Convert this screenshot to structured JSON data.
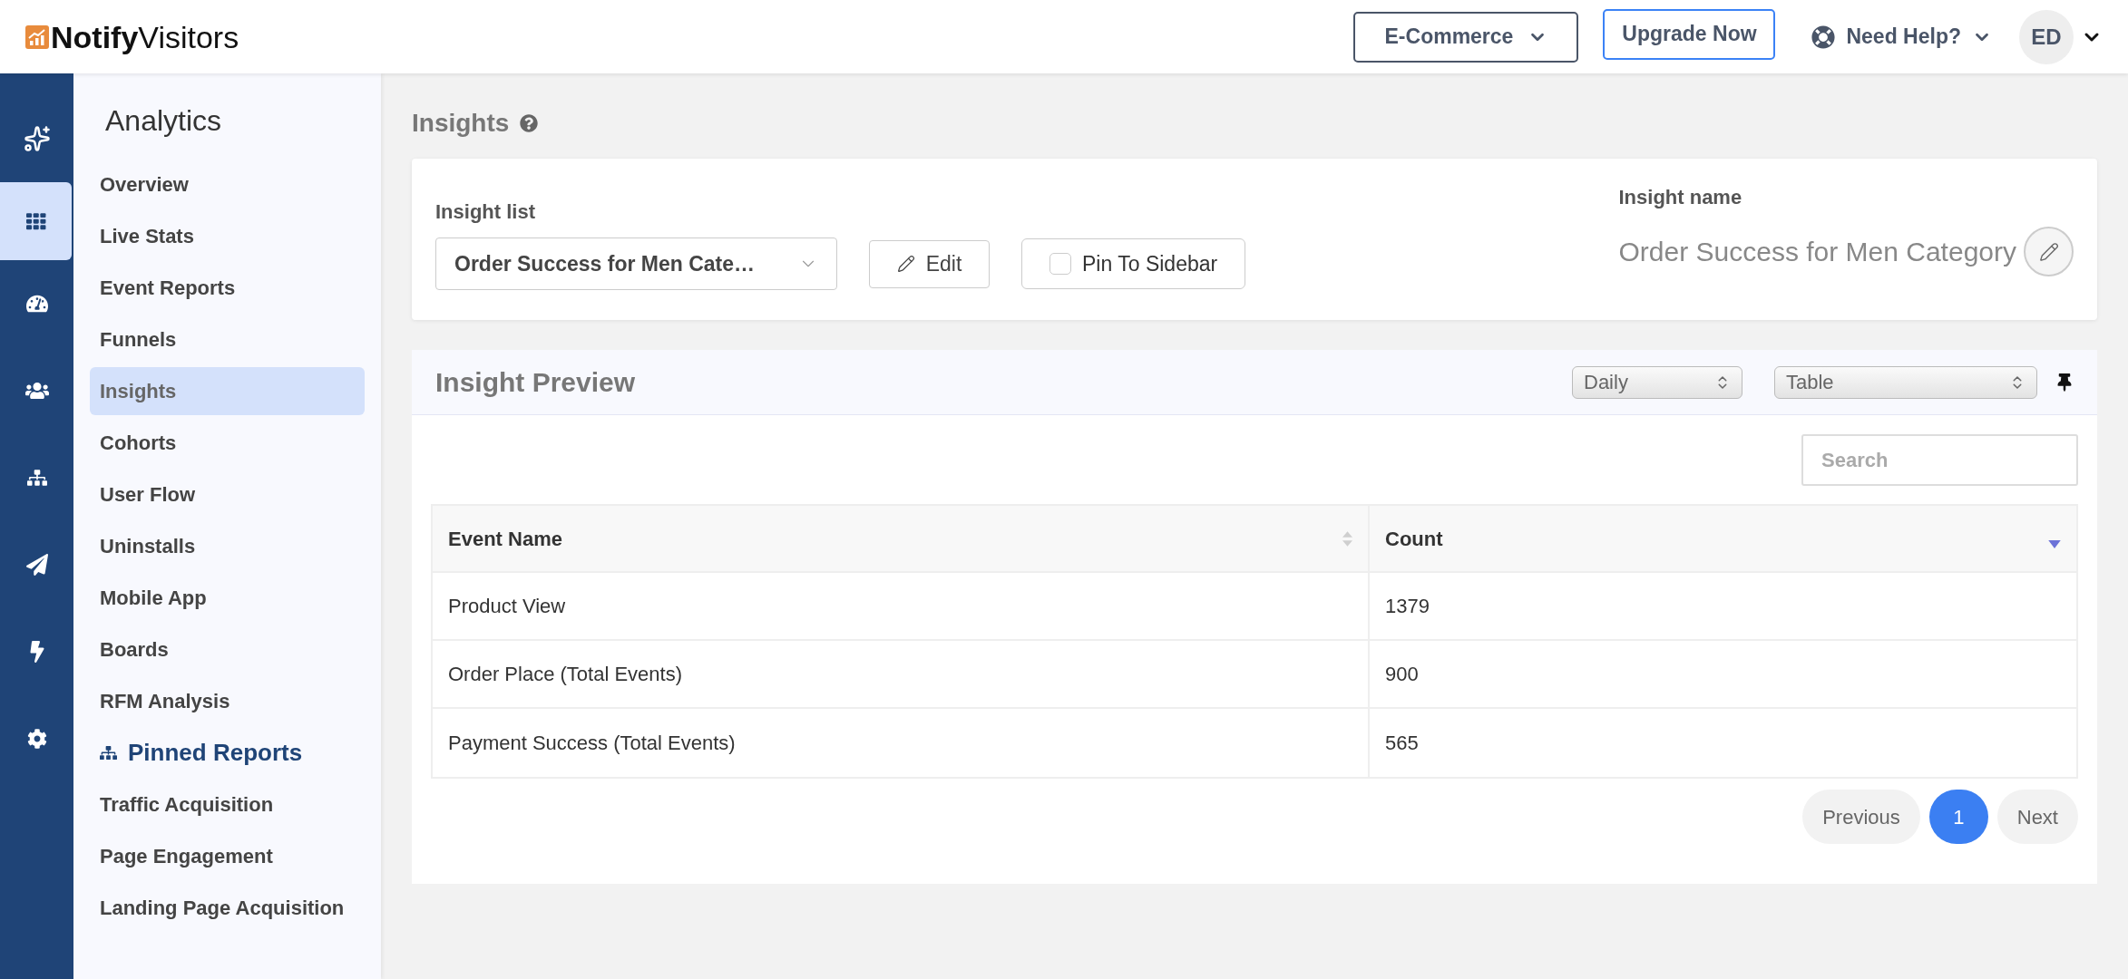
{
  "header": {
    "logo_bold": "Notify",
    "logo_light": "Visitors",
    "workspace": "E-Commerce",
    "upgrade_button": "Upgrade Now",
    "help": "Need Help?",
    "avatar": "ED"
  },
  "rail": [
    {
      "kind": "sparkles",
      "selected": false
    },
    {
      "kind": "grid",
      "selected": true
    },
    {
      "kind": "gauge",
      "selected": false
    },
    {
      "kind": "users",
      "selected": false
    },
    {
      "kind": "sitemap",
      "selected": false
    },
    {
      "kind": "send",
      "selected": false
    },
    {
      "kind": "bolt",
      "selected": false
    },
    {
      "kind": "settings",
      "selected": false
    }
  ],
  "sidebar": {
    "title": "Analytics",
    "items": [
      {
        "label": "Overview",
        "selected": false
      },
      {
        "label": "Live Stats",
        "selected": false
      },
      {
        "label": "Event Reports",
        "selected": false
      },
      {
        "label": "Funnels",
        "selected": false
      },
      {
        "label": "Insights",
        "selected": true
      },
      {
        "label": "Cohorts",
        "selected": false
      },
      {
        "label": "User Flow",
        "selected": false
      },
      {
        "label": "Uninstalls",
        "selected": false
      },
      {
        "label": "Mobile App",
        "selected": false
      },
      {
        "label": "Boards",
        "selected": false
      },
      {
        "label": "RFM Analysis",
        "selected": false
      }
    ],
    "pinned_title": "Pinned Reports",
    "pinned_items": [
      {
        "label": "Traffic Acquisition"
      },
      {
        "label": "Page Engagement"
      },
      {
        "label": "Landing Page Acquisition"
      }
    ]
  },
  "page_title": "Insights",
  "insight_card": {
    "list_label": "Insight list",
    "list_value": "Order Success for Men Cate…",
    "edit_button": "Edit",
    "pin_checkbox": {
      "label": "Pin To Sidebar",
      "checked": false
    },
    "name_label": "Insight name",
    "name_value": "Order Success for Men Category"
  },
  "preview": {
    "title": "Insight Preview",
    "interval": "Daily",
    "view": "Table",
    "search_placeholder": "Search",
    "table": {
      "columns": [
        {
          "label": "Event Name",
          "sorted": false
        },
        {
          "label": "Count",
          "sorted": true
        }
      ],
      "rows": [
        [
          "Product View",
          "1379"
        ],
        [
          "Order Place (Total Events)",
          "900"
        ],
        [
          "Payment Success (Total Events)",
          "565"
        ]
      ]
    },
    "pagination": {
      "previous": "Previous",
      "pages": [
        {
          "label": "1",
          "selected": true
        }
      ],
      "next": "Next"
    }
  }
}
